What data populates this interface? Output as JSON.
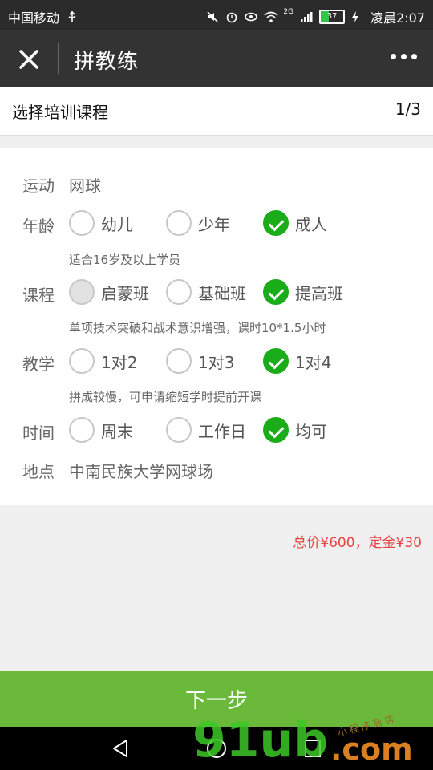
{
  "statusbar": {
    "carrier": "中国移动",
    "network": "2G",
    "battery": "37",
    "battery_level": 0.37,
    "time": "凌晨2:07"
  },
  "topbar": {
    "title": "拼教练",
    "close_icon": "close-icon",
    "more_icon": "more-icon"
  },
  "step": {
    "title": "选择培训课程",
    "counter": "1/3"
  },
  "form": {
    "sport": {
      "label": "运动",
      "value": "网球"
    },
    "age": {
      "label": "年龄",
      "options": [
        "幼儿",
        "少年",
        "成人"
      ],
      "selected": "成人",
      "hint": "适合16岁及以上学员"
    },
    "course": {
      "label": "课程",
      "options": [
        "启蒙班",
        "基础班",
        "提高班"
      ],
      "selected": "提高班",
      "disabled": "启蒙班",
      "hint": "单项技术突破和战术意识增强，课时10*1.5小时"
    },
    "teaching": {
      "label": "教学",
      "options": [
        "1对2",
        "1对3",
        "1对4"
      ],
      "selected": "1对4",
      "hint": "拼成较慢，可申请缩短学时提前开课"
    },
    "time": {
      "label": "时间",
      "options": [
        "周末",
        "工作日",
        "均可"
      ],
      "selected": "均可"
    },
    "location": {
      "label": "地点",
      "value": "中南民族大学网球场"
    }
  },
  "price_text": "总价¥600，定金¥30",
  "next_button": "下一步",
  "watermark": {
    "main": "91ub",
    "suffix": ".com",
    "tag": "小程序商店"
  },
  "colors": {
    "accent_green": "#1aad19",
    "button_green": "#6ab93b",
    "price_red": "#e64340",
    "topbar": "#333333"
  }
}
